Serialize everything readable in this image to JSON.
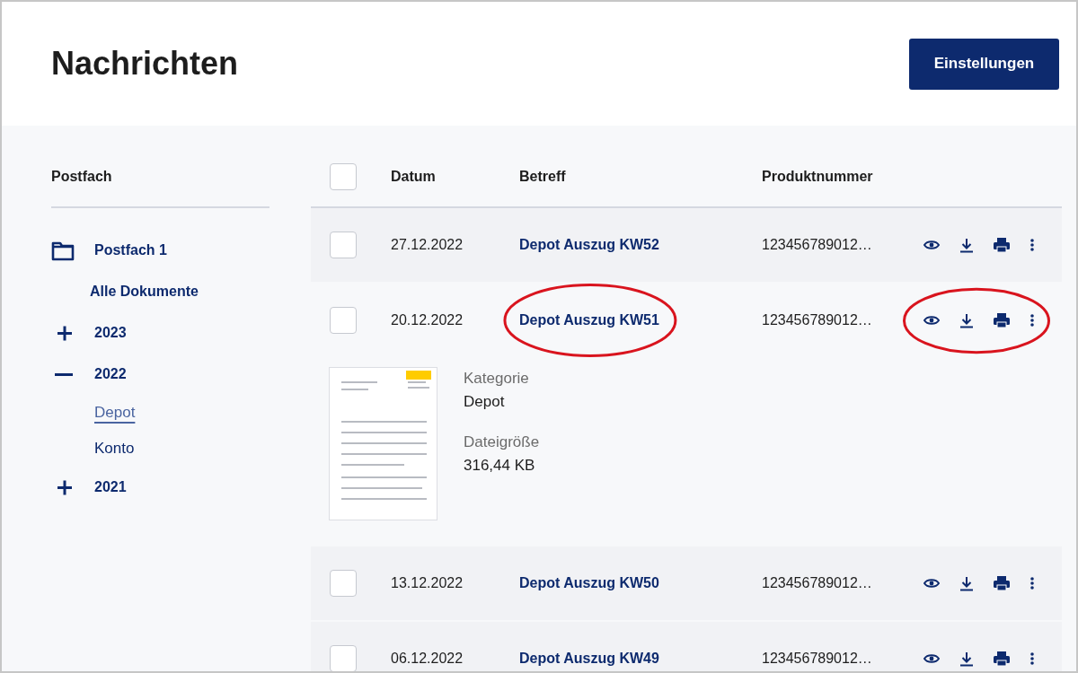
{
  "header": {
    "title": "Nachrichten",
    "settings_button": "Einstellungen"
  },
  "sidebar": {
    "heading": "Postfach",
    "items": [
      {
        "kind": "mailbox",
        "label": "Postfach 1"
      },
      {
        "kind": "link",
        "label": "Alle Dokumente",
        "selected": false
      },
      {
        "kind": "year",
        "label": "2023",
        "expanded": false
      },
      {
        "kind": "year",
        "label": "2022",
        "expanded": true,
        "children": [
          {
            "label": "Depot",
            "selected": true
          },
          {
            "label": "Konto",
            "selected": false
          }
        ]
      },
      {
        "kind": "year",
        "label": "2021",
        "expanded": false
      }
    ]
  },
  "table": {
    "columns": [
      "Datum",
      "Betreff",
      "Produktnummer"
    ],
    "all_checked": false,
    "rows": [
      {
        "date": "27.12.2022",
        "subject": "Depot Auszug KW52",
        "product": "123456789012…",
        "checked": false,
        "expanded": false,
        "subject_circled": false,
        "actions_circled": false
      },
      {
        "date": "20.12.2022",
        "subject": "Depot Auszug KW51",
        "product": "123456789012…",
        "checked": false,
        "expanded": true,
        "subject_circled": true,
        "actions_circled": true,
        "preview": {
          "kind": "picture"
        },
        "details": [
          {
            "label": "Kategorie",
            "value": "Depot"
          },
          {
            "label": "Dateigröße",
            "value": "316,44 KB"
          }
        ]
      },
      {
        "date": "13.12.2022",
        "subject": "Depot Auszug KW50",
        "product": "123456789012…",
        "checked": false,
        "expanded": false,
        "subject_circled": false,
        "actions_circled": false
      },
      {
        "date": "06.12.2022",
        "subject": "Depot Auszug KW49",
        "product": "123456789012…",
        "checked": false,
        "expanded": false,
        "subject_circled": false,
        "actions_circled": false
      }
    ]
  }
}
